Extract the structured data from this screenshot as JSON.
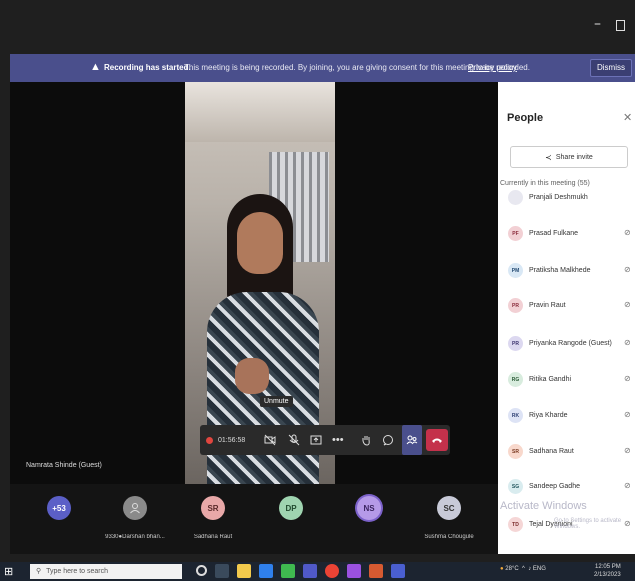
{
  "titlebar": {
    "minimize_glyph": "–"
  },
  "banner": {
    "title": "Recording has started.",
    "message": "This meeting is being recorded. By joining, you are giving consent for this meeting to be recorded.",
    "link": "Privacy policy",
    "dismiss": "Dismiss",
    "color": "#4a4f8c"
  },
  "stage": {
    "tooltip": "Unmute",
    "timer": "01:56:58",
    "speaker_name": "Namrata Shinde (Guest)"
  },
  "toolbar": {
    "icons": [
      "camera-off-icon",
      "mic-off-icon",
      "share-icon",
      "more-icon",
      "raise-hand-icon",
      "chat-icon",
      "people-icon",
      "leave-icon"
    ]
  },
  "strip": {
    "tiles": [
      {
        "initials": "+53",
        "label": "",
        "color": "#5b5fc7"
      },
      {
        "initials": "",
        "label": "9330●Darshan bhan...",
        "color": "#8a8a8a"
      },
      {
        "initials": "SR",
        "label": "Sadhana Raut",
        "color": "#e8a8a8"
      },
      {
        "initials": "DP",
        "label": "",
        "color": "#9fd4b0"
      },
      {
        "initials": "NS",
        "label": "",
        "color": "#b59ae8"
      },
      {
        "initials": "SC",
        "label": "Sushma Chougule",
        "color": "#c8cad8"
      }
    ]
  },
  "panel": {
    "title": "People",
    "share_invite": "Share invite",
    "section": "Currently in this meeting (55)",
    "people": [
      {
        "initials": "",
        "name": "Pranjali Deshmukh",
        "color": "#e8e8f0"
      },
      {
        "initials": "PF",
        "name": "Prasad Fulkane",
        "color": "#f2d0d4"
      },
      {
        "initials": "PM",
        "name": "Pratiksha Malkhede",
        "color": "#d9e8f5"
      },
      {
        "initials": "PR",
        "name": "Pravin Raut",
        "color": "#f2d0d4"
      },
      {
        "initials": "PR",
        "name": "Priyanka Rangode (Guest)",
        "color": "#dcd8f0"
      },
      {
        "initials": "RG",
        "name": "Ritika Gandhi",
        "color": "#d8ecde"
      },
      {
        "initials": "RK",
        "name": "Riya Kharde",
        "color": "#dde3f5"
      },
      {
        "initials": "SR",
        "name": "Sadhana Raut",
        "color": "#f8d8cc"
      },
      {
        "initials": "SG",
        "name": "Sandeep Gadhe",
        "color": "#d9ecef"
      },
      {
        "initials": "TD",
        "name": "Tejal Dyanioni",
        "color": "#f5d6d6"
      }
    ],
    "watermark_title": "Activate Windows",
    "watermark_sub": "Go to Settings to activate Windows."
  },
  "taskbar": {
    "search_placeholder": "Type here to search",
    "weather": "28°C",
    "time": "12:05 PM",
    "date": "2/13/2023",
    "lang": "ENG"
  }
}
